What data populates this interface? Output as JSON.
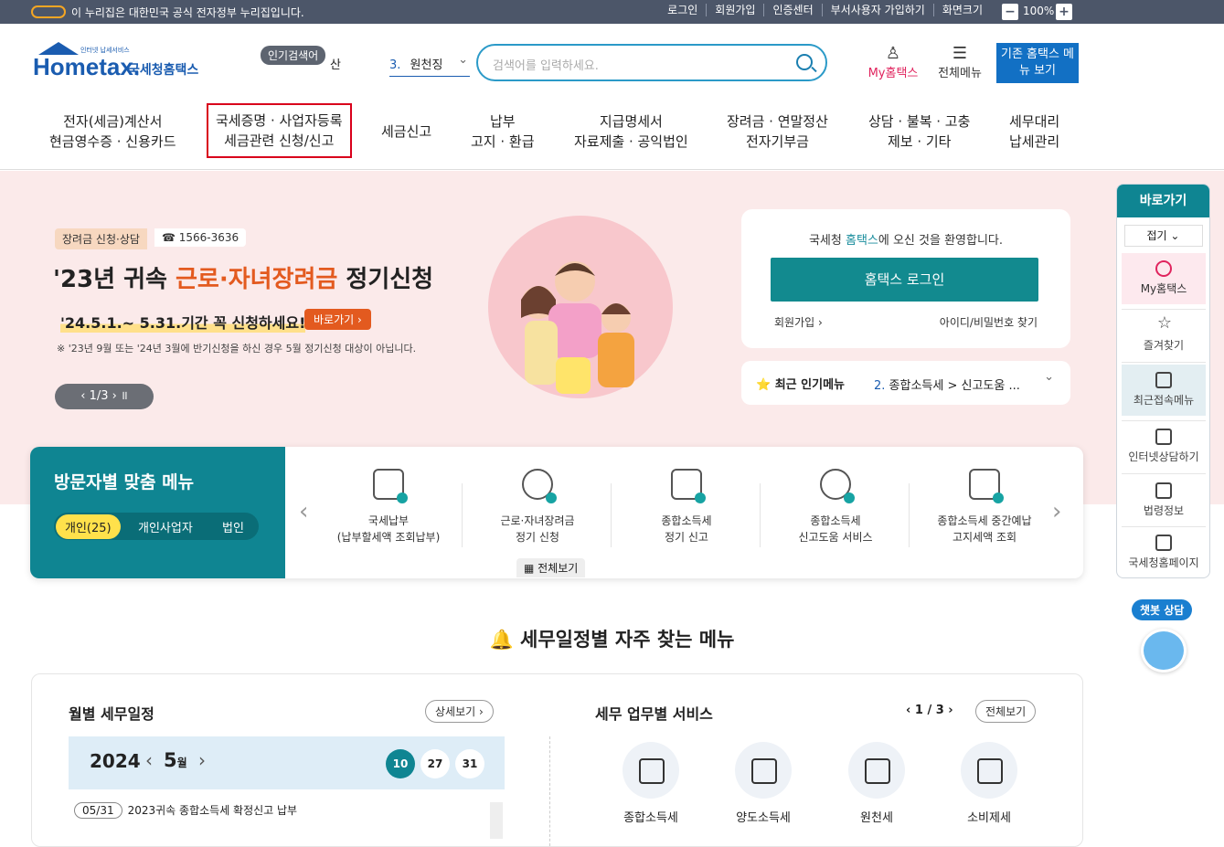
{
  "topbar": {
    "gov_notice": "이 누리집은 대한민국 공식 전자정부 누리집입니다.",
    "links": [
      "로그인",
      "회원가입",
      "인증센터",
      "부서사용자 가입하기",
      "화면크기"
    ],
    "zoom": "100%",
    "zoom_minus": "−",
    "zoom_plus": "+"
  },
  "header": {
    "logo_sub": "인터넷 납세서비스",
    "logo_en": "Hometax.",
    "logo_kr": "국세청홈택스",
    "popular_tag": "인기검색어",
    "popular_keyword": "산",
    "popular_rank": "3.",
    "popular_rank_word": "원천징",
    "search_placeholder": "검색어를 입력하세요.",
    "my_hometax": "My홈택스",
    "all_menu": "전체메뉴",
    "old_hometax": "기존 홈택스 메뉴 보기"
  },
  "gnb": [
    {
      "l1": "전자(세금)계산서",
      "l2": "현금영수증 · 신용카드"
    },
    {
      "l1": "국세증명 · 사업자등록",
      "l2": "세금관련 신청/신고"
    },
    {
      "l1": "세금신고",
      "l2": ""
    },
    {
      "l1": "납부",
      "l2": "고지 · 환급"
    },
    {
      "l1": "지급명세서",
      "l2": "자료제출 · 공익법인"
    },
    {
      "l1": "장려금 · 연말정산",
      "l2": "전자기부금"
    },
    {
      "l1": "상담 · 불복 · 고충",
      "l2": "제보 · 기타"
    },
    {
      "l1": "세무대리",
      "l2": "납세관리"
    }
  ],
  "hero": {
    "tag": "장려금 신청·상담",
    "phone": "☎ 1566-3636",
    "title_a": "'23년 귀속 ",
    "title_hl": "근로·자녀장려금",
    "title_b": " 정기신청",
    "sub": "'24.5.1.~ 5.31.기간 꼭 신청하세요!",
    "go": "바로가기 ›",
    "note": "※ '23년 9월 또는 '24년 3월에 반기신청을 하신 경우 5월 정기신청 대상이 아닙니다.",
    "pager": "‹  1/3  ›   ॥"
  },
  "welcome": {
    "msg_a": "국세청 ",
    "msg_h": "홈택스",
    "msg_b": "에 오신 것을 환영합니다.",
    "login": "홈택스 로그인",
    "join": "회원가입 ›",
    "find": "아이디/비밀번호 찾기"
  },
  "popular_menu": {
    "title": "⭐ 최근 인기메뉴",
    "rank": "2.",
    "value": "종합소득세 > 신고도움 ...",
    "chev": "⌄"
  },
  "visitor": {
    "title": "방문자별 맞춤 메뉴",
    "tabs": [
      "개인(25)",
      "개인사업자",
      "법인"
    ],
    "items": [
      {
        "l1": "국세납부",
        "l2": "(납부할세액 조회납부)"
      },
      {
        "l1": "근로·자녀장려금",
        "l2": "정기 신청"
      },
      {
        "l1": "종합소득세",
        "l2": "정기 신고"
      },
      {
        "l1": "종합소득세",
        "l2": "신고도움 서비스"
      },
      {
        "l1": "종합소득세 중간예납",
        "l2": "고지세액 조회"
      }
    ],
    "view_all": "▦ 전체보기",
    "prev": "‹",
    "next": "›"
  },
  "schedule_title": "세무일정별 자주 찾는 메뉴",
  "monthly": {
    "title": "월별 세무일정",
    "detail": "상세보기 ›",
    "year": "2024",
    "month": "5",
    "month_unit": "월",
    "days": [
      "10",
      "27",
      "31"
    ],
    "event_date": "05/31",
    "event": "2023귀속 종합소득세 확정신고 납부"
  },
  "services": {
    "title": "세무 업무별 서비스",
    "page": "‹  1 / 3  ›",
    "all": "전체보기",
    "items": [
      "종합소득세",
      "양도소득세",
      "원천세",
      "소비제세"
    ]
  },
  "quick": {
    "title": "바로가기",
    "fold": "접기 ⌄",
    "items": [
      "My홈택스",
      "즐겨찾기",
      "최근접속메뉴",
      "인터넷상담하기",
      "법령정보",
      "국세청홈페이지"
    ]
  },
  "chatbot": "챗봇 상담",
  "colors": {
    "teal": "#0f8592",
    "accent": "#e35a1f",
    "topbar": "#4c5669",
    "hero_bg": "#fbeaea"
  }
}
